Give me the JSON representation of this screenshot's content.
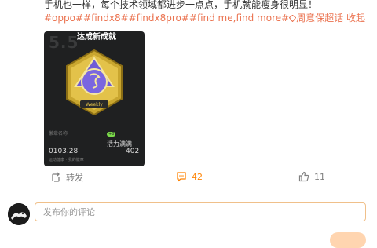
{
  "post": {
    "line1": "手机也一样，每个技术领域都进步一点点，手机就能瘦身很明显！",
    "hashtags": "#oppo##findx8##findx8pro##find me,find more#",
    "super_topic": "周意保超话",
    "collapse": "收起"
  },
  "media": {
    "big_number": "5.5",
    "top_tag": "达成新成就",
    "small_label": "徽章名称",
    "time": "0103.28",
    "stat_label": "活力满满",
    "badge": "+8",
    "bottom_left": "运动健康 · 我的徽章",
    "right_number": "402"
  },
  "actions": {
    "repost": "转发",
    "comment_count": "42",
    "like_count": "11"
  },
  "comment": {
    "placeholder": "发布你的评论"
  },
  "colors": {
    "accent": "#eb7350",
    "comment_highlight": "#ff8200",
    "input_border": "#f0c08a"
  }
}
